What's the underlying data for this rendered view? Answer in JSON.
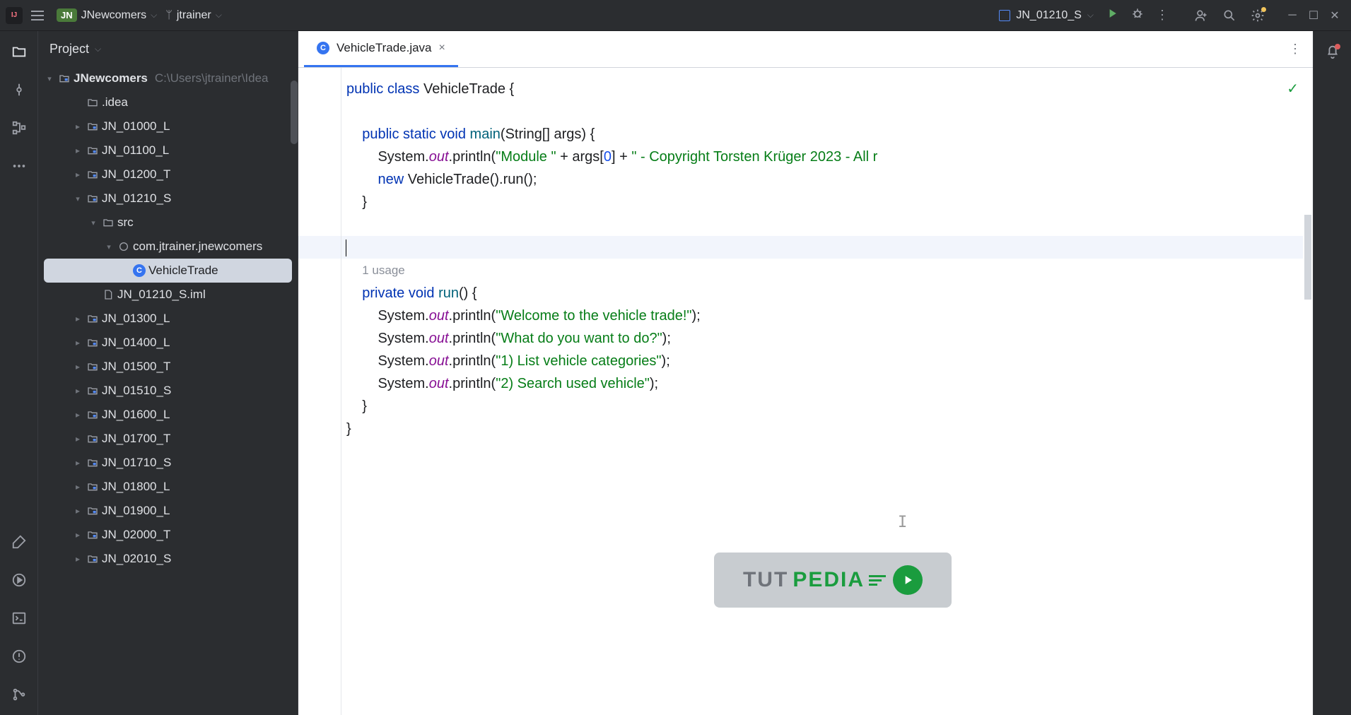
{
  "titlebar": {
    "project_badge": "JN",
    "project_name": "JNewcomers",
    "user_label": "jtrainer",
    "run_config": "JN_01210_S"
  },
  "sidebar": {
    "header": "Project",
    "root": {
      "name": "JNewcomers",
      "path": "C:\\Users\\jtrainer\\Idea"
    },
    "items": [
      {
        "name": ".idea",
        "type": "folder",
        "depth": 1,
        "arrow": null
      },
      {
        "name": "JN_01000_L",
        "type": "module",
        "depth": 1,
        "arrow": "right"
      },
      {
        "name": "JN_01100_L",
        "type": "module",
        "depth": 1,
        "arrow": "right"
      },
      {
        "name": "JN_01200_T",
        "type": "module",
        "depth": 1,
        "arrow": "right"
      },
      {
        "name": "JN_01210_S",
        "type": "module",
        "depth": 1,
        "arrow": "down"
      },
      {
        "name": "src",
        "type": "folder",
        "depth": 2,
        "arrow": "down"
      },
      {
        "name": "com.jtrainer.jnewcomers",
        "type": "package",
        "depth": 3,
        "arrow": "down"
      },
      {
        "name": "VehicleTrade",
        "type": "class",
        "depth": 4,
        "arrow": null,
        "selected": true
      },
      {
        "name": "JN_01210_S.iml",
        "type": "file",
        "depth": 2,
        "arrow": null
      },
      {
        "name": "JN_01300_L",
        "type": "module",
        "depth": 1,
        "arrow": "right"
      },
      {
        "name": "JN_01400_L",
        "type": "module",
        "depth": 1,
        "arrow": "right"
      },
      {
        "name": "JN_01500_T",
        "type": "module",
        "depth": 1,
        "arrow": "right"
      },
      {
        "name": "JN_01510_S",
        "type": "module",
        "depth": 1,
        "arrow": "right"
      },
      {
        "name": "JN_01600_L",
        "type": "module",
        "depth": 1,
        "arrow": "right"
      },
      {
        "name": "JN_01700_T",
        "type": "module",
        "depth": 1,
        "arrow": "right"
      },
      {
        "name": "JN_01710_S",
        "type": "module",
        "depth": 1,
        "arrow": "right"
      },
      {
        "name": "JN_01800_L",
        "type": "module",
        "depth": 1,
        "arrow": "right"
      },
      {
        "name": "JN_01900_L",
        "type": "module",
        "depth": 1,
        "arrow": "right"
      },
      {
        "name": "JN_02000_T",
        "type": "module",
        "depth": 1,
        "arrow": "right"
      },
      {
        "name": "JN_02010_S",
        "type": "module",
        "depth": 1,
        "arrow": "right"
      }
    ]
  },
  "tab": {
    "filename": "VehicleTrade.java"
  },
  "code": {
    "usage_hint": "1 usage",
    "l1_public": "public",
    "l1_class": "class",
    "l1_name": " VehicleTrade {",
    "l2_spaces": "    ",
    "l2_public": "public",
    "l2_static": " static",
    "l2_void": " void",
    "l2_main": " main",
    "l2_rest": "(String[] args) {",
    "l3_spaces": "        System.",
    "l3_out": "out",
    "l3_rest1": ".println(",
    "l3_str1": "\"Module \"",
    "l3_mid": " + args[",
    "l3_num": "0",
    "l3_mid2": "] + ",
    "l3_str2": "\" - Copyright Torsten Krüger 2023 - All r",
    "l4_spaces": "        ",
    "l4_new": "new",
    "l4_rest": " VehicleTrade().run();",
    "l5": "    }",
    "l7_spaces": "    ",
    "l7_private": "private",
    "l7_void": " void",
    "l7_run": " run",
    "l7_rest": "() {",
    "l8a": "        System.",
    "l8o": "out",
    "l8b": ".println(",
    "l8s": "\"Welcome to the vehicle trade!\"",
    "l8c": ");",
    "l9a": "        System.",
    "l9o": "out",
    "l9b": ".println(",
    "l9s": "\"What do you want to do?\"",
    "l9c": ");",
    "l10a": "        System.",
    "l10o": "out",
    "l10b": ".println(",
    "l10s": "\"1) List vehicle categories\"",
    "l10c": ");",
    "l11a": "        System.",
    "l11o": "out",
    "l11b": ".println(",
    "l11s": "\"2) Search used vehicle\"",
    "l11c": ");",
    "l12": "    }",
    "l13": "}"
  },
  "logo": {
    "t1": "TUT",
    "t2": "PEDIA"
  }
}
